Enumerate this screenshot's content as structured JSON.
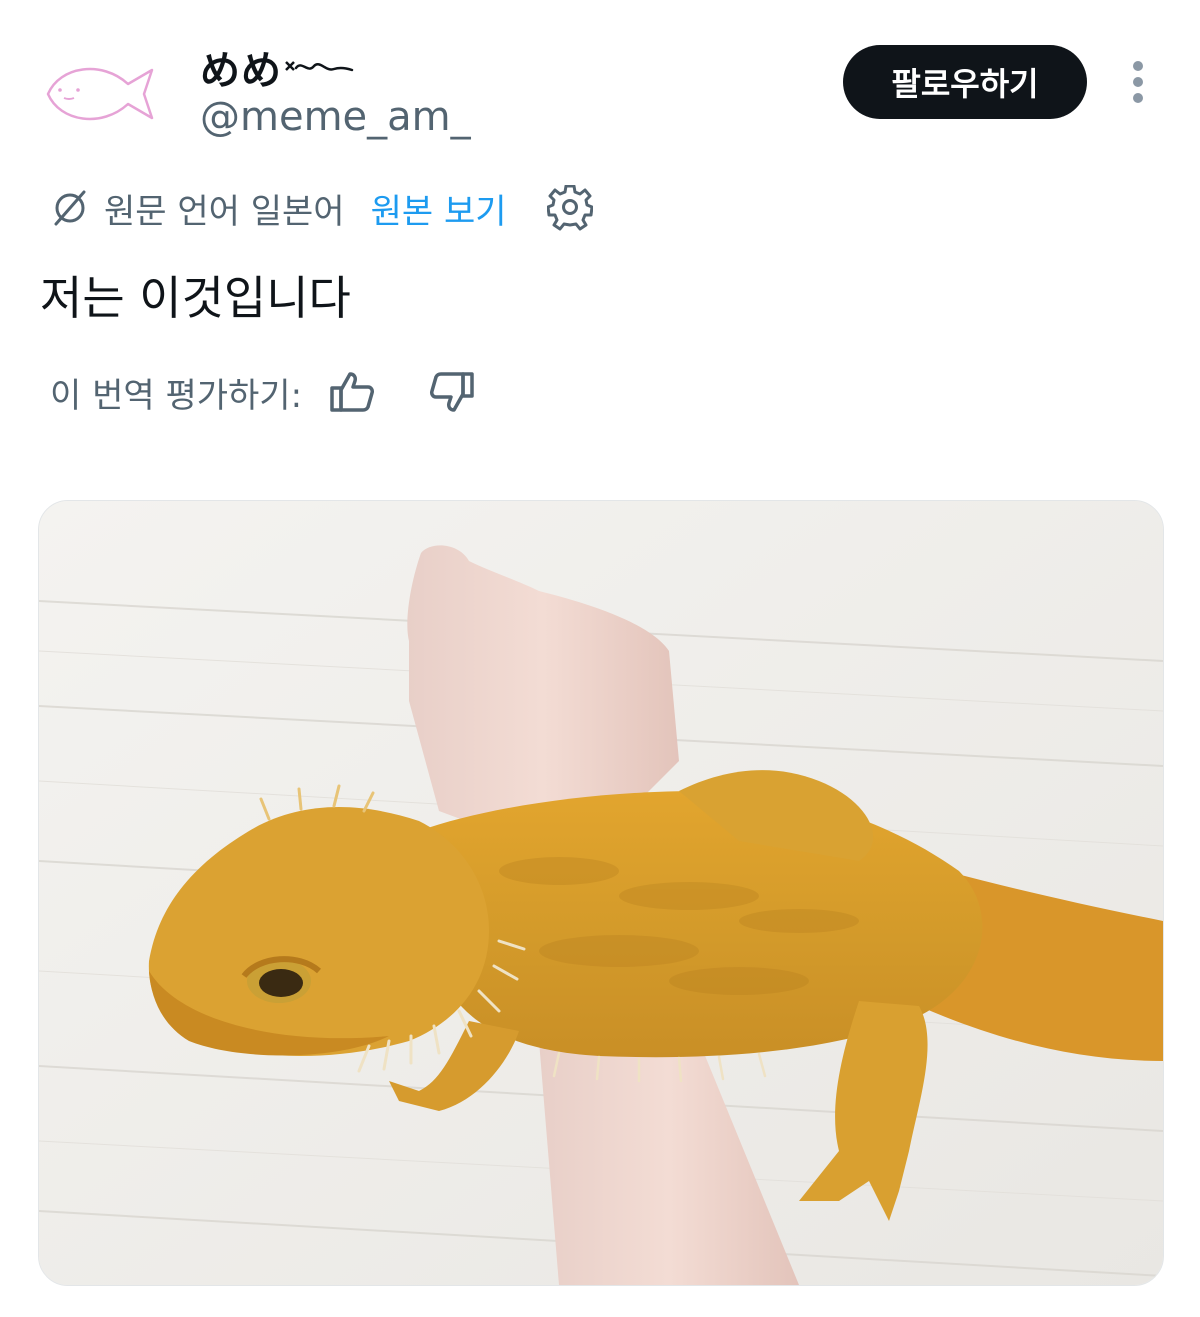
{
  "user": {
    "display_name": "めめ",
    "handle": "@meme_am_"
  },
  "actions": {
    "follow_label": "팔로우하기"
  },
  "translation": {
    "source_language": "원문 언어 일본어",
    "show_original": "원본 보기"
  },
  "tweet": {
    "text": "저는 이것입니다"
  },
  "rating": {
    "label": "이 번역 평가하기:"
  },
  "icons": {
    "avatar": "fish-avatar",
    "more": "more-vertical-icon",
    "translate": "globe-slash-icon",
    "settings": "gear-icon",
    "like": "thumbs-up-icon",
    "dislike": "thumbs-down-icon"
  },
  "colors": {
    "link": "#1d9bf0",
    "follow_button_bg": "#0f1419",
    "secondary_text": "#536471"
  }
}
